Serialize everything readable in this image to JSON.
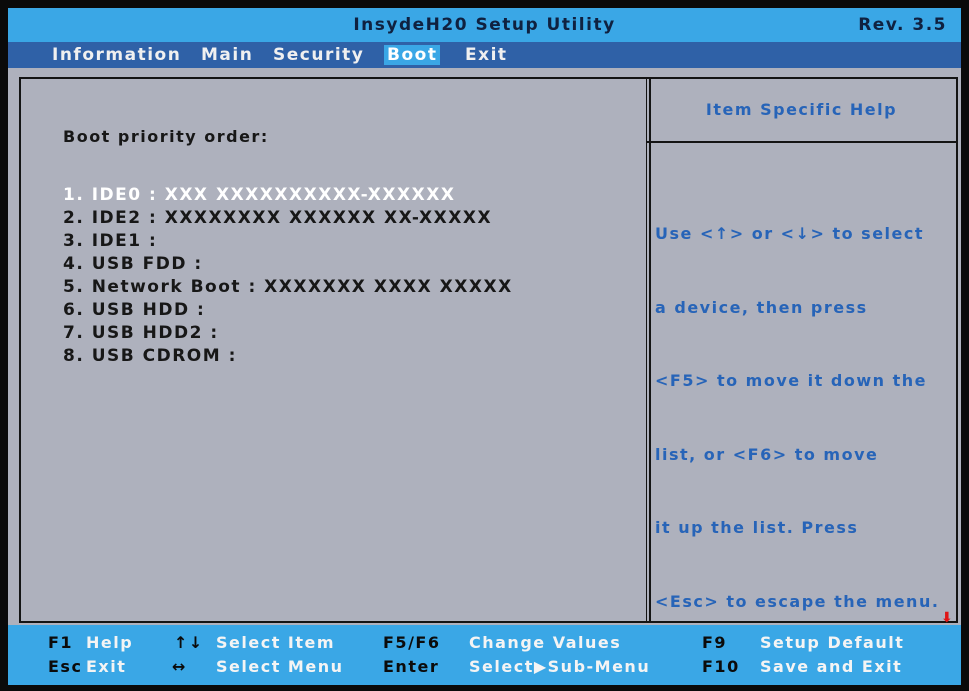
{
  "title_bar": {
    "title": "InsydeH20 Setup Utility",
    "revision": "Rev. 3.5"
  },
  "menu": [
    {
      "label": "Information",
      "active": false
    },
    {
      "label": "Main",
      "active": false
    },
    {
      "label": "Security",
      "active": false
    },
    {
      "label": "Boot",
      "active": true
    },
    {
      "label": "Exit",
      "active": false
    }
  ],
  "boot": {
    "heading": "Boot priority order:",
    "items": [
      "1. IDE0 : XXX XXXXXXXXXX-XXXXXX",
      "2. IDE2 : XXXXXXXX XXXXXX XX-XXXXX",
      "3. IDE1 :",
      "4. USB FDD :",
      "5. Network Boot : XXXXXXX XXXX XXXXX",
      "6. USB HDD :",
      "7. USB HDD2 :",
      "8. USB CDROM :"
    ],
    "selected_index": 0
  },
  "help": {
    "header": "Item Specific Help",
    "lines": [
      "Use <↑> or <↓> to select",
      "a device, then press",
      "<F5> to move it down the",
      "list, or <F6> to move",
      "it up the list. Press",
      "<Esc> to escape the menu."
    ]
  },
  "footer": {
    "row1": [
      {
        "key": "F1",
        "action": "Help"
      },
      {
        "key": "↑↓",
        "action": "Select Item"
      },
      {
        "key": "F5/F6",
        "action": "Change Values"
      },
      {
        "key": "F9",
        "action": "Setup Default"
      }
    ],
    "row2": [
      {
        "key": "Esc",
        "action": "Exit"
      },
      {
        "key": "↔",
        "action": "Select Menu"
      },
      {
        "key": "Enter",
        "action": "Select▶Sub-Menu"
      },
      {
        "key": "F10",
        "action": "Save and Exit"
      }
    ]
  },
  "scroll_indicator": "down-arrow-icon",
  "colors": {
    "title_bar_bg": "#3aa7e6",
    "menu_bar_bg": "#2f61a7",
    "body_bg": "#aeb1bd",
    "help_text": "#2764b8",
    "selected_item": "#ffffff",
    "scroll_arrow": "#e01515"
  }
}
